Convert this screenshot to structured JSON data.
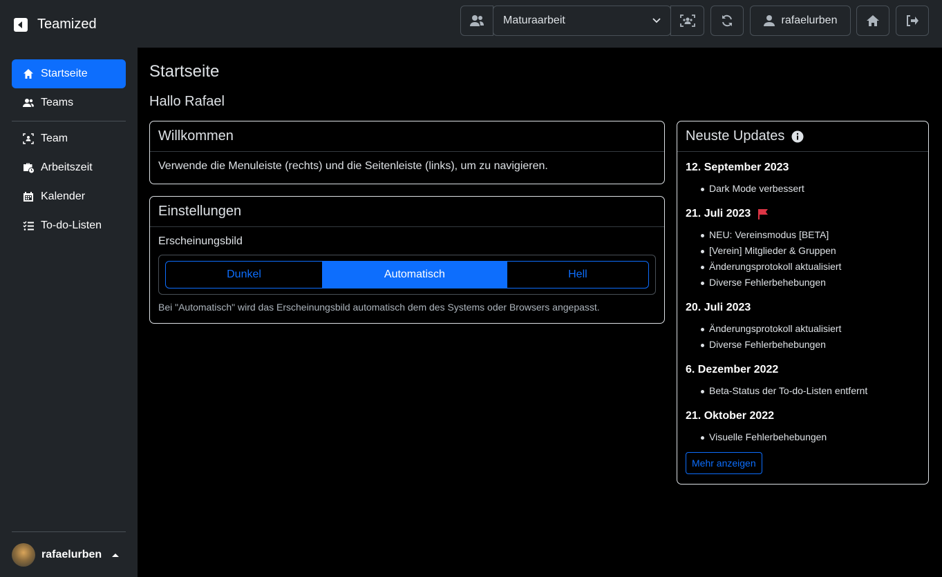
{
  "app": {
    "title": "Teamized"
  },
  "header": {
    "team_selected": "Maturaarbeit",
    "username": "rafaelurben"
  },
  "sidebar": {
    "items": [
      {
        "label": "Startseite",
        "icon": "house-icon",
        "active": true
      },
      {
        "label": "Teams",
        "icon": "users-icon"
      },
      {
        "label": "Team",
        "icon": "team-scan-icon"
      },
      {
        "label": "Arbeitszeit",
        "icon": "business-time-icon"
      },
      {
        "label": "Kalender",
        "icon": "calendar-icon"
      },
      {
        "label": "To-do-Listen",
        "icon": "list-check-icon"
      }
    ],
    "user": "rafaelurben"
  },
  "main": {
    "title": "Startseite",
    "greeting": "Hallo Rafael",
    "welcome": {
      "title": "Willkommen",
      "text": "Verwende die Menuleiste (rechts) und die Seitenleiste (links), um zu navigieren."
    },
    "settings": {
      "title": "Einstellungen",
      "label": "Erscheinungsbild",
      "options": [
        "Dunkel",
        "Automatisch",
        "Hell"
      ],
      "selected": "Automatisch",
      "hint": "Bei \"Automatisch\" wird das Erscheinungsbild automatisch dem des Systems oder Browsers angepasst."
    },
    "updates": {
      "title": "Neuste Updates",
      "entries": [
        {
          "date": "12. September 2023",
          "items": [
            "Dark Mode verbessert"
          ]
        },
        {
          "date": "21. Juli 2023",
          "flag": true,
          "items": [
            "NEU: Vereinsmodus [BETA]",
            "[Verein] Mitglieder & Gruppen",
            "Änderungsprotokoll aktualisiert",
            "Diverse Fehlerbehebungen"
          ]
        },
        {
          "date": "20. Juli 2023",
          "items": [
            "Änderungsprotokoll aktualisiert",
            "Diverse Fehlerbehebungen"
          ]
        },
        {
          "date": "6. Dezember 2022",
          "items": [
            "Beta-Status der To-do-Listen entfernt"
          ]
        },
        {
          "date": "21. Oktober 2022",
          "items": [
            "Visuelle Fehlerbehebungen"
          ]
        }
      ],
      "more_label": "Mehr anzeigen"
    }
  },
  "colors": {
    "accent": "#0d6efd",
    "flag": "#dc3545",
    "panel": "#212529"
  }
}
